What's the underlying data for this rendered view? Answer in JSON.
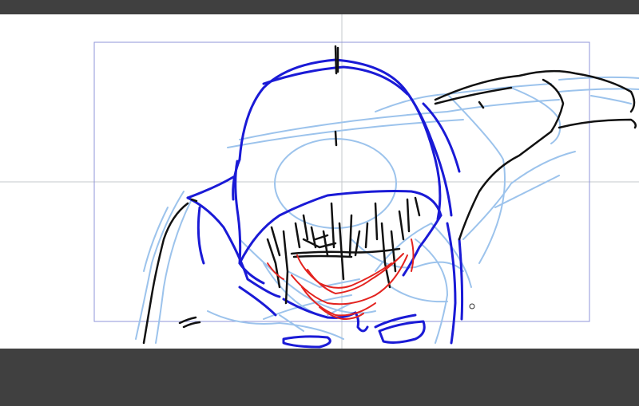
{
  "app": {
    "background_color": "#404040",
    "canvas_color": "#ffffff"
  },
  "canvas": {
    "guide_color": "#8f95d8",
    "crosshair_color": "#c5c8cc",
    "layers": [
      {
        "name": "rough-sketch",
        "color": "#9cc3ec"
      },
      {
        "name": "hood-outline",
        "color": "#1a1ad6"
      },
      {
        "name": "ink-lines",
        "color": "#111111"
      },
      {
        "name": "face-lines",
        "color": "#e3231f"
      }
    ]
  },
  "cursor": {
    "icon": "brush-cursor-icon"
  }
}
